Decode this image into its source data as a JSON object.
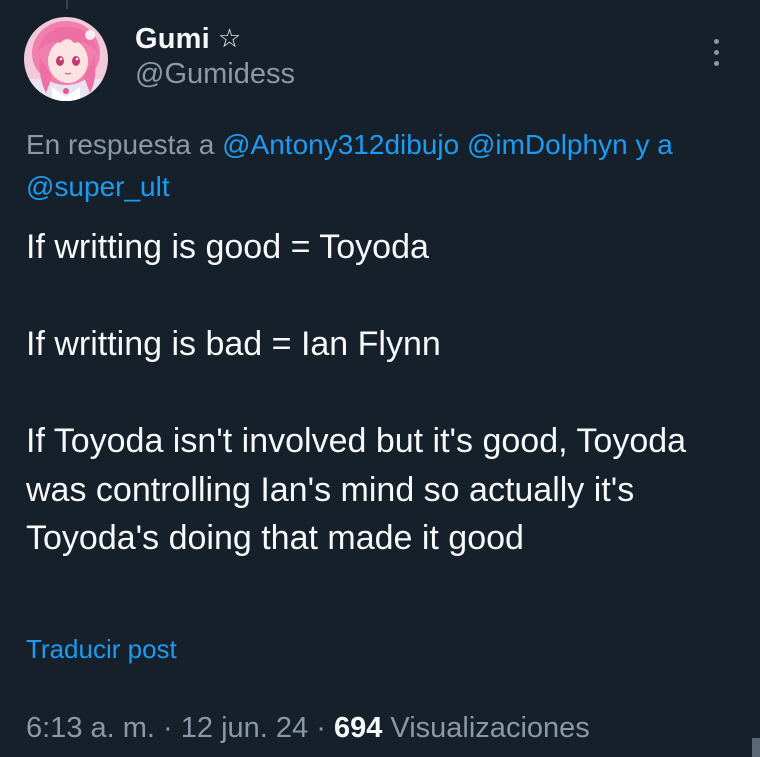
{
  "author": {
    "display_name": "Gumi",
    "badge_icon": "star-outline-icon",
    "badge_glyph": "☆",
    "handle": "@Gumidess",
    "avatar": "anime-character-pink-hair-avatar"
  },
  "more_options": {
    "icon": "vertical-ellipsis-icon"
  },
  "reply_context": {
    "prefix": "En respuesta a",
    "mention_1": "@Antony312dibujo",
    "mention_2": "@imDolphyn",
    "suffix": "y a",
    "mention_3": "@super_ult"
  },
  "tweet": {
    "line_1": "If writting is good = Toyoda",
    "line_2": "If writting is bad = Ian Flynn",
    "line_3": "If Toyoda isn't involved but it's good, Toyoda was controlling Ian's mind so actually it's Toyoda's doing that made it good"
  },
  "translate_label": "Traducir post",
  "meta": {
    "time": "6:13 a. m.",
    "separator": "·",
    "date": "12 jun. 24",
    "views_count": "694",
    "views_label": "Visualizaciones"
  },
  "colors": {
    "background": "#15202b",
    "text_primary": "#f7f9f9",
    "text_secondary": "#8b98a5",
    "link": "#1d9bf0"
  }
}
